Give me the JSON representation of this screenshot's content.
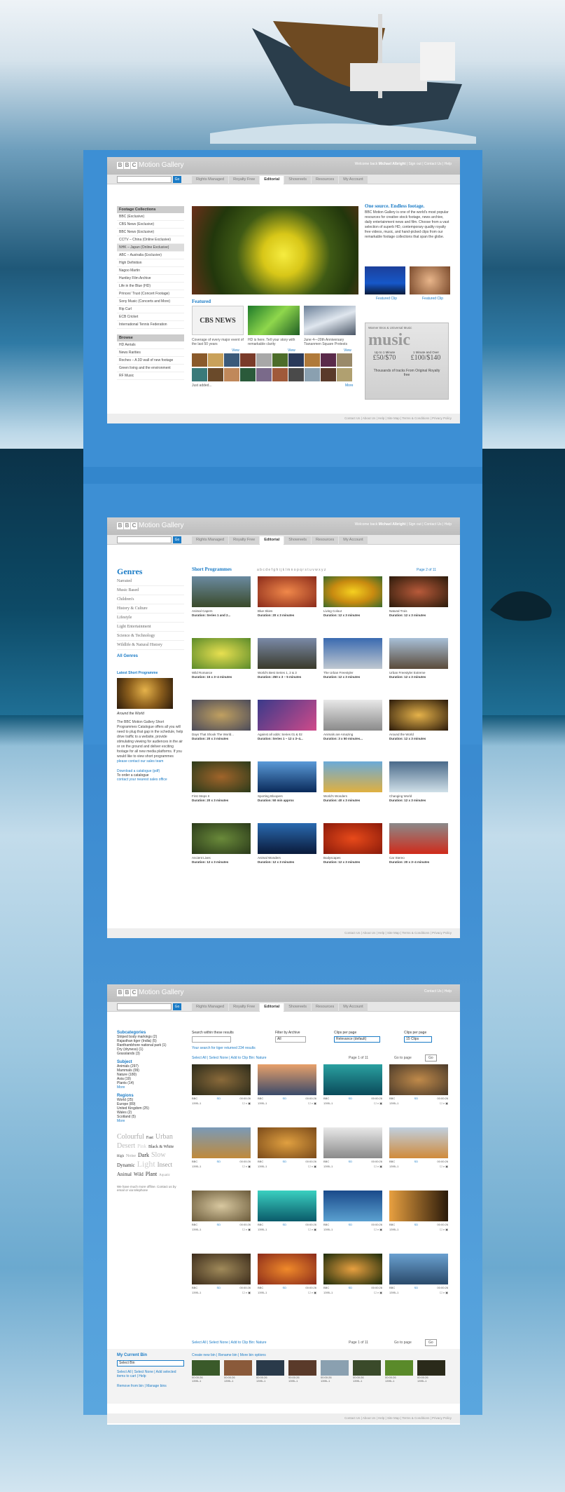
{
  "brand": {
    "bbc": [
      "B",
      "B",
      "C"
    ],
    "motion_gallery": "Motion Gallery"
  },
  "header": {
    "welcome": "Welcome back",
    "user": "Michael Albright",
    "signout": "Sign out",
    "contact": "Contact Us",
    "help": "Help"
  },
  "search": {
    "go": "Go"
  },
  "tabs": [
    "Rights Managed",
    "Royalty Free",
    "Editorial",
    "Showreels",
    "Resources",
    "My Account"
  ],
  "footer": "Contact Us | About Us | Help | Site Map | Terms & Conditions | Privacy Policy",
  "page1": {
    "collections_title": "Footage Collections",
    "collections": [
      "BBC (Exclusive)",
      "CBS News (Exclusive)",
      "BBC News (Exclusive)",
      "CCTV – China (Online Exclusive)",
      "NHK – Japan (Online Exclusive)",
      "ABC – Australia (Exclusive)",
      "High Definition",
      "Nagoo Martin",
      "Huntley Film Archive",
      "Life in the Blue (HD)",
      "Princes' Trust (Concert Footage)",
      "Sony Music (Concerts and More)",
      "Rip Curl",
      "ECB Cricket",
      "International Tennis Federation"
    ],
    "browse_title": "Browse",
    "browse": [
      "HD Aerials",
      "News Rarities",
      "Roches – A 3D wall of new footage",
      "Green living and the environment",
      "RF Music"
    ],
    "intro_title": "One source. Endless footage.",
    "intro": "BBC Motion Gallery is one of the world's most popular resources for creative stock footage, news archive, daily entertainment news and film. Choose from a vast selection of superb HD, contemporary quality royalty free videos, music, and hand-picked clips from our remarkable footage collections that span the globe.",
    "featured_clip1": "Featured Clip",
    "featured_clip2": "Featured Clip",
    "featured_title": "Featured",
    "feat": [
      {
        "caption": "Coverage of every major event of the last 50 years",
        "link": "View"
      },
      {
        "caption": "HD is here. Tell your story with remarkable clarity",
        "link": "View"
      },
      {
        "caption": "June 4—20th Anniversary Tiananmen Square Protests",
        "link": "View"
      }
    ],
    "cbs_logo": "CBS NEWS",
    "just_added": "Just added...",
    "more": "More",
    "music_ad": {
      "top": "Warner Bros & Universal Music",
      "word": "music",
      "c1": "Up to 1 Minute",
      "c1p": "£50/$70",
      "c2": "1 Minute and Over",
      "c2p": "£100/$140",
      "sub": "Thousands of tracks From Original Royalty free"
    }
  },
  "page2": {
    "genres_title": "Genres",
    "genres": [
      "Narrated",
      "Music Based",
      "Children's",
      "History & Culture",
      "Lifestyle",
      "Light Entertainment",
      "Science & Technology",
      "Wildlife & Natural History"
    ],
    "all_genres": "All Genres",
    "latest_title": "Latest Short Programme",
    "latest_name": "Around the World",
    "latest_desc": "The BBC Motion Gallery Short Programmes Catalogue offers all you will need to plug that gap in the schedule, help drive traffic to a website, provide stimulating viewing for audiences in the air or on the ground and deliver exciting footage for all new media platforms. If you would like to view short programmes",
    "contact_link": "please contact our sales team",
    "catalogue_link": "Download a catalogue (pdf)",
    "order_text": "To order a catalogue",
    "office_link": "contact your nearest sales office",
    "short_title": "Short Programmes",
    "alphabet": "a b c d e f g h i j k l m n o p q r s t u v w x y z",
    "pager": "Page 2 of 11",
    "programmes": [
      {
        "title": "Animal Capers",
        "duration": "Duration: Series 1 and 2..."
      },
      {
        "title": "Blue Skies",
        "duration": "Duration: 20 x 3 minutes"
      },
      {
        "title": "Living Colour",
        "duration": "Duration: 12 x 3 minutes"
      },
      {
        "title": "Natural Trois",
        "duration": "Duration: 12 x 3 minutes"
      },
      {
        "title": "Wild Romance",
        "duration": "Duration: 15 x 3–4 minutes"
      },
      {
        "title": "World's Best Series 1, 2 & 3",
        "duration": "Duration: 250 x 3 – 5 minutes"
      },
      {
        "title": "The Urban Freestyler",
        "duration": "Duration: 12 x 3 minutes"
      },
      {
        "title": "Urban Freestyler Extreme",
        "duration": "Duration: 12 x 3 minutes"
      },
      {
        "title": "Days That Shook The World...",
        "duration": "Duration: 20 x 3 minutes"
      },
      {
        "title": "Against all odds: Series 01 & 02",
        "duration": "Duration: Series 1 – 12 x 3–4..."
      },
      {
        "title": "Animals are Amazing",
        "duration": "Duration: 3 x 50 minutes..."
      },
      {
        "title": "Around the World",
        "duration": "Duration: 12 x 3 minutes"
      },
      {
        "title": "First Steps II",
        "duration": "Duration: 20 x 3 minutes"
      },
      {
        "title": "Sporting Bloopers",
        "duration": "Duration: 50 min approx"
      },
      {
        "title": "World's Wonders",
        "duration": "Duration: 40 x 3 minutes"
      },
      {
        "title": "Changing World",
        "duration": "Duration: 12 x 3 minutes"
      },
      {
        "title": "Ancient Lives",
        "duration": "Duration: 12 x 3 minutes"
      },
      {
        "title": "Animal Wonders",
        "duration": "Duration: 12 x 3 minutes"
      },
      {
        "title": "Bodyscapes",
        "duration": "Duration: 12 x 3 minutes"
      },
      {
        "title": "Car Stereo",
        "duration": "Duration: 20 x 3–4 minutes"
      }
    ]
  },
  "page3": {
    "subcat_title": "Subcategories",
    "subcats": [
      "Striped body markings (2)",
      "Rajasthan tiger (India) (5)",
      "Ranthambhore national park (1)",
      "Dry (dryness) (1)",
      "Grasslands (3)"
    ],
    "subject_title": "Subject",
    "subjects": [
      "Animals (297)",
      "Mammals (99)",
      "Nature (180)",
      "Asia (19)",
      "Plants (14)"
    ],
    "regions_title": "Regions",
    "regions": [
      "World (25)",
      "Europe (89)",
      "United Kingdom (25)",
      "Wales (2)",
      "Scotland (5)"
    ],
    "more": "More",
    "tags": [
      "Colourful",
      "Fast",
      "Urban",
      "Desert",
      "Pink",
      "Black & White",
      "High",
      "Noise",
      "Dark",
      "Slow",
      "Dynamic",
      "Light",
      "Insect",
      "Animal",
      "Wild",
      "Plant",
      "Aquatic"
    ],
    "offline_note": "We have much more offline. Contact us by email or via telephone",
    "search_within": "Search within these results",
    "filter_archive": "Filter by Archive",
    "filter_archive_val": "All",
    "clips_per_page": "Clips per page",
    "sort_val": "Relevance (default)",
    "clips_per_page2": "Clips per page",
    "clips_val": "15 Clips",
    "result_note": "Your search for tiger returned 234 results",
    "select_all": "Select All | Select None | Add to Clip Bin: Nature",
    "pager": "Page 1 of 11",
    "goto": "Go to page",
    "go": "Go",
    "clip_id": "1395–1",
    "clip_time": "00:00:26",
    "clip_src": "BBC",
    "clip_fmt": "SD",
    "bin_title": "My Current Bin",
    "bin_select": "Select Bin",
    "bin_links": "Select All | Select None | Add selected items to cart | Help",
    "bin_remove": "Remove from bin | Manage bins",
    "bin_actions": "Create new bin | Rename bin | More bin options"
  },
  "colors": {
    "accent": "#1a7bc6",
    "frame": "#3d8fd4"
  }
}
